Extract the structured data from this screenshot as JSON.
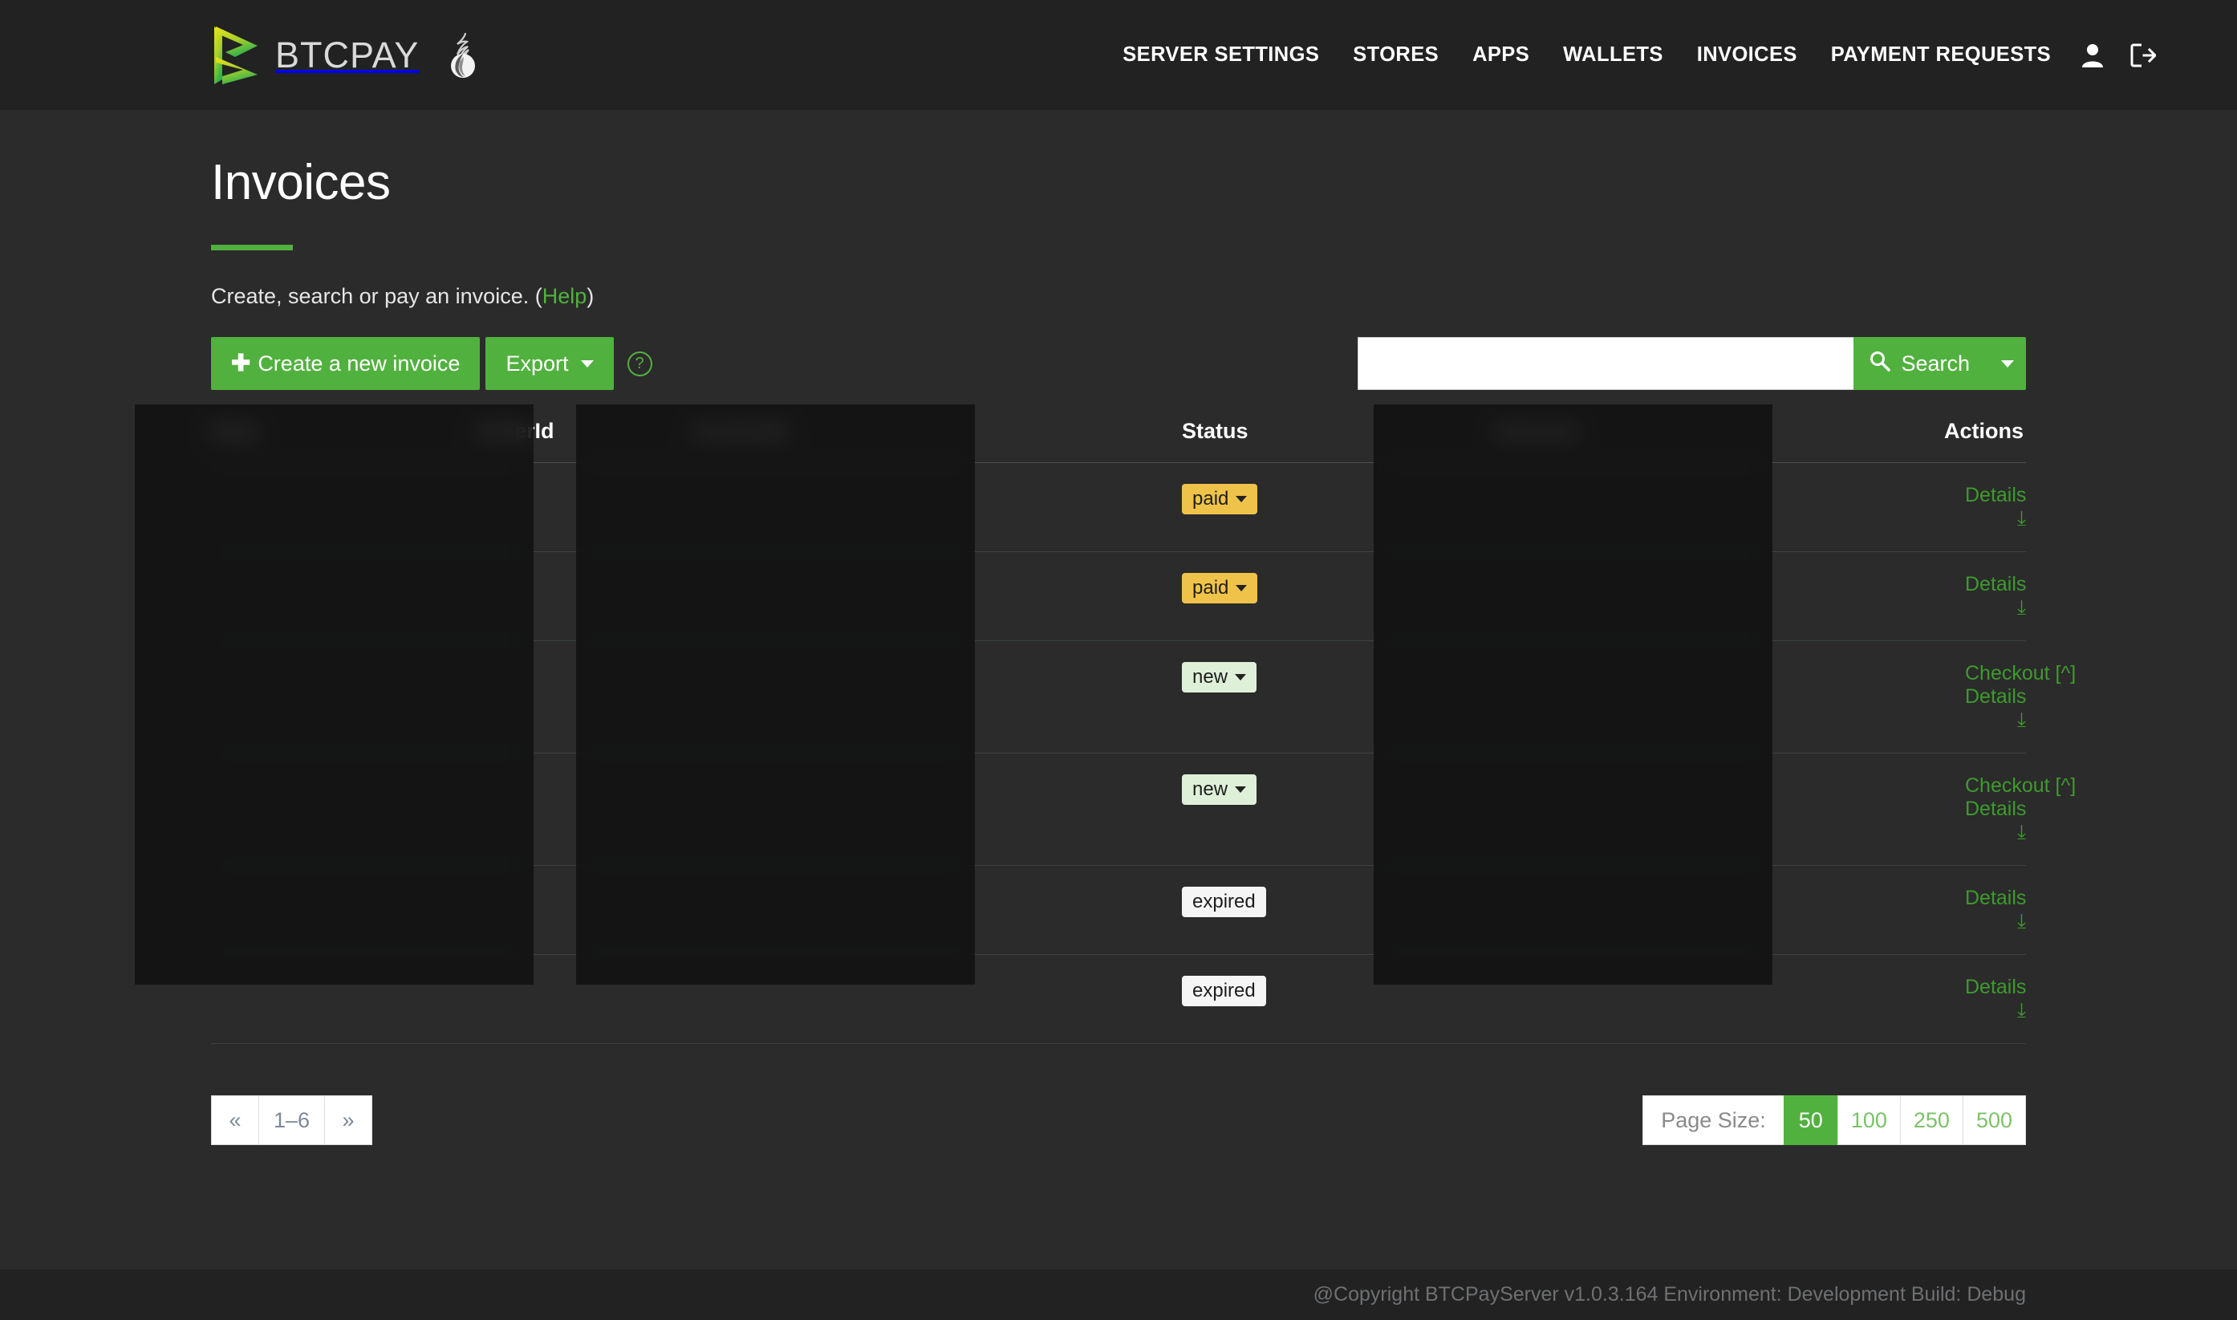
{
  "header": {
    "brand_name": "BTCPAY",
    "brand_logo_icon": "btcpay-b-logo-icon",
    "tor_icon": "tor-onion-icon",
    "nav": [
      {
        "label": "SERVER SETTINGS"
      },
      {
        "label": "STORES"
      },
      {
        "label": "APPS"
      },
      {
        "label": "WALLETS"
      },
      {
        "label": "INVOICES"
      },
      {
        "label": "PAYMENT REQUESTS"
      }
    ],
    "account_icon": "user-icon",
    "logout_icon": "sign-out-icon"
  },
  "page": {
    "title": "Invoices",
    "lead_text": "Create, search or pay an invoice. (",
    "lead_link": "Help",
    "lead_text_end": ")"
  },
  "toolbar": {
    "create_label": "Create a new invoice",
    "create_icon": "plus-icon",
    "export_label": "Export",
    "export_caret_icon": "caret-down-icon",
    "help_icon": "question-circle-icon",
    "help_glyph": "?"
  },
  "search": {
    "value": "",
    "placeholder": "",
    "button_label": "Search",
    "search_icon": "search-icon",
    "split_caret_icon": "caret-down-icon"
  },
  "table": {
    "columns": [
      {
        "key": "date",
        "label": "Date",
        "redacted": true
      },
      {
        "key": "order",
        "label": "OrderId",
        "redacted": true
      },
      {
        "key": "invid",
        "label": "InvoiceId",
        "redacted": true
      },
      {
        "key": "status",
        "label": "Status",
        "redacted": false
      },
      {
        "key": "amount",
        "label": "Amount",
        "redacted": true
      },
      {
        "key": "actions",
        "label": "Actions",
        "redacted": false
      }
    ],
    "header_status": "Status",
    "header_actions": "Actions",
    "rows": [
      {
        "status": "paid",
        "status_has_caret": true,
        "checkout_label": "",
        "details_label": "Details",
        "details_icon": "double-chevron-down-icon"
      },
      {
        "status": "paid",
        "status_has_caret": true,
        "checkout_label": "",
        "details_label": "Details",
        "details_icon": "double-chevron-down-icon"
      },
      {
        "status": "new",
        "status_has_caret": true,
        "checkout_label": "Checkout [^]",
        "details_label": "Details",
        "details_icon": "double-chevron-down-icon"
      },
      {
        "status": "new",
        "status_has_caret": true,
        "checkout_label": "Checkout [^]",
        "details_label": "Details",
        "details_icon": "double-chevron-down-icon"
      },
      {
        "status": "expired",
        "status_has_caret": false,
        "checkout_label": "",
        "details_label": "Details",
        "details_icon": "double-chevron-down-icon"
      },
      {
        "status": "expired",
        "status_has_caret": false,
        "checkout_label": "",
        "details_label": "Details",
        "details_icon": "double-chevron-down-icon"
      }
    ]
  },
  "pagination": {
    "prev_label": "«",
    "range_label": "1–6",
    "next_label": "»"
  },
  "page_size": {
    "label": "Page Size:",
    "options": [
      "50",
      "100",
      "250",
      "500"
    ],
    "selected": "50"
  },
  "footer": {
    "text": "@Copyright BTCPayServer v1.0.3.164 Environment: Development Build: Debug"
  },
  "colors": {
    "accent_green": "#51b13e",
    "link_green": "#3f9a2f",
    "header_bg": "#222222",
    "body_bg": "#2b2b2b",
    "badge_paid": "#efc34a",
    "badge_new": "#dff0d8",
    "badge_expired": "#f5f5f5"
  }
}
